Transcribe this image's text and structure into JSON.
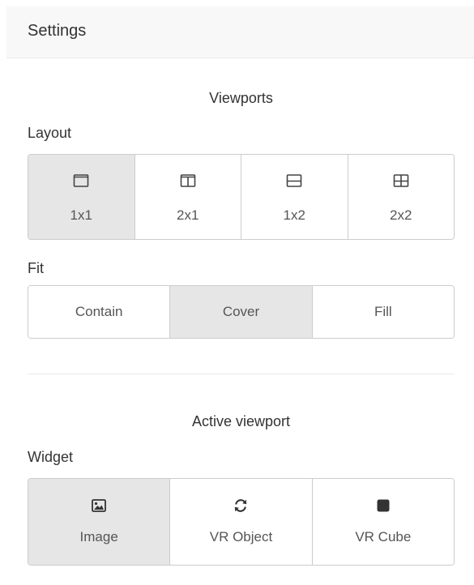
{
  "panel": {
    "title": "Settings"
  },
  "viewports": {
    "section_title": "Viewports",
    "layout_label": "Layout",
    "layout_options": [
      {
        "label": "1x1",
        "icon": "single-pane-icon",
        "active": true
      },
      {
        "label": "2x1",
        "icon": "two-columns-icon",
        "active": false
      },
      {
        "label": "1x2",
        "icon": "two-rows-icon",
        "active": false
      },
      {
        "label": "2x2",
        "icon": "grid-2x2-icon",
        "active": false
      }
    ],
    "fit_label": "Fit",
    "fit_options": [
      {
        "label": "Contain",
        "active": false
      },
      {
        "label": "Cover",
        "active": true
      },
      {
        "label": "Fill",
        "active": false
      }
    ]
  },
  "active_viewport": {
    "section_title": "Active viewport",
    "widget_label": "Widget",
    "widget_options": [
      {
        "label": "Image",
        "icon": "image-icon",
        "active": true
      },
      {
        "label": "VR Object",
        "icon": "rotate-icon",
        "active": false
      },
      {
        "label": "VR Cube",
        "icon": "cube-icon",
        "active": false
      }
    ]
  },
  "colors": {
    "active_button_bg": "#e6e6e6",
    "border": "#cccccc",
    "header_bg": "#f8f8f8"
  }
}
